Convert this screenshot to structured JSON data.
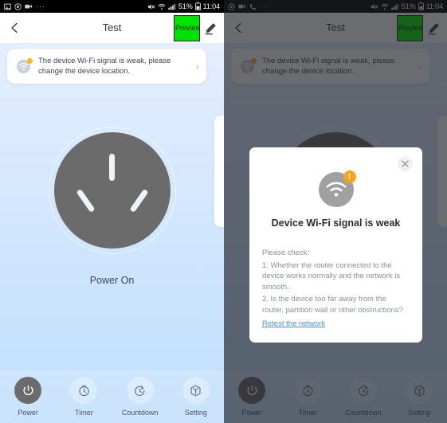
{
  "statusbar": {
    "left_icons_panel1": [
      "image-icon",
      "circle-icon",
      "camcorder-icon",
      "overflow-dots-icon"
    ],
    "left_icons_panel2": [
      "circle-icon",
      "camcorder-icon",
      "phone-icon",
      "overflow-dots-icon"
    ],
    "dots": "···",
    "mute_icon": "mute-icon",
    "wifi_icon": "wifi-icon",
    "signal_icon": "signal-icon",
    "battery_percent": "51%",
    "battery_icon": "battery-icon",
    "time": "11:04"
  },
  "appbar": {
    "back_icon": "back-arrow-icon",
    "title": "Test",
    "preview_label": "Preview",
    "edit_icon": "pencil-edit-icon"
  },
  "banner": {
    "icon": "wifi-warning-icon",
    "text": "The device Wi-Fi signal is weak, please change the device location.",
    "chevron": "›"
  },
  "device": {
    "socket_icon": "power-socket-icon",
    "state_label": "Power On"
  },
  "bottomnav": {
    "items": [
      {
        "label": "Power",
        "icon": "power-icon",
        "active": true
      },
      {
        "label": "Timer",
        "icon": "clock-icon",
        "active": false
      },
      {
        "label": "Countdown",
        "icon": "countdown-icon",
        "active": false
      },
      {
        "label": "Setting",
        "icon": "cube-settings-icon",
        "active": false
      }
    ]
  },
  "dialog": {
    "close_icon": "close-icon",
    "icon": "wifi-icon",
    "badge": "!",
    "title": "Device Wi-Fi signal is weak",
    "intro": "Please check:",
    "line1": "1. Whether the router connected to the device works normally and the network is smooth.",
    "line2": "2. Is the device too far away from the router, partition wall or other obstructions?",
    "link": "Retest the network"
  },
  "colors": {
    "accent_green": "#00e300",
    "warning_orange": "#f8a41b",
    "link_blue": "#4a8fe0",
    "socket_gray": "#6b6b6b"
  }
}
